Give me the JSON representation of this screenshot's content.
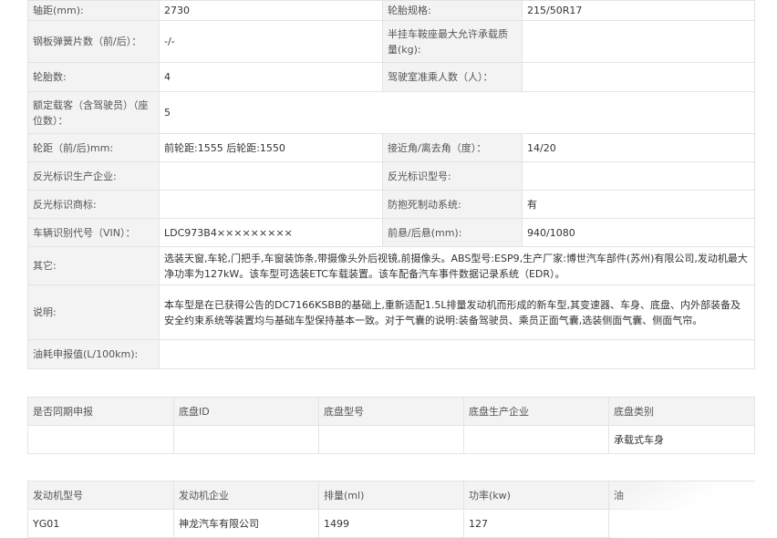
{
  "spec": {
    "wheelbase_label": "轴距(mm):",
    "wheelbase_value": "2730",
    "tire_label": "轮胎规格:",
    "tire_value": "215/50R17",
    "leaf_spring_label": "钢板弹簧片数（前/后）：",
    "leaf_spring_value": "-/-",
    "saddle_label": "半挂车鞍座最大允许承载质量(kg):",
    "saddle_value": "",
    "tire_count_label": "轮胎数:",
    "tire_count_value": "4",
    "cab_passengers_label": "驾驶室准乘人数（人）：",
    "cab_passengers_value": "",
    "rated_passengers_label": "额定载客（含驾驶员）（座位数）：",
    "rated_passengers_value": "5",
    "track_label": "轮距（前/后)mm:",
    "track_value": "前轮距:1555 后轮距:1550",
    "angle_label": "接近角/离去角（度）：",
    "angle_value": "14/20",
    "reflector_maker_label": "反光标识生产企业:",
    "reflector_maker_value": "",
    "reflector_model_label": "反光标识型号:",
    "reflector_model_value": "",
    "reflector_brand_label": "反光标识商标:",
    "reflector_brand_value": "",
    "abs_label": "防抱死制动系统:",
    "abs_value": "有",
    "vin_label": "车辆识别代号（VIN）：",
    "vin_value": "LDC973B4×××××××××",
    "overhang_label": "前悬/后悬(mm):",
    "overhang_value": "940/1080",
    "other_label": "其它:",
    "other_value": "选装天窗,车轮,门把手,车窗装饰条,带摄像头外后视镜,前摄像头。ABS型号:ESP9,生产厂家:博世汽车部件(苏州)有限公司,发动机最大净功率为127kW。该车型可选装ETC车载装置。该车配备汽车事件数据记录系统（EDR）。",
    "note_label": "说明:",
    "note_value": "本车型是在已获得公告的DC7166KSBB的基础上,重新适配1.5L排量发动机而形成的新车型,其变速器、车身、底盘、内外部装备及安全约束系统等装置均与基础车型保持基本一致。对于气囊的说明:装备驾驶员、乘员正面气囊,选装侧面气囊、侧面气帘。",
    "fuel_label": "油耗申报值(L/100km):",
    "fuel_value": ""
  },
  "chassis": {
    "headers": [
      "是否同期申报",
      "底盘ID",
      "底盘型号",
      "底盘生产企业",
      "底盘类别"
    ],
    "row": [
      "",
      "",
      "",
      "",
      "承载式车身"
    ]
  },
  "engine": {
    "headers": [
      "发动机型号",
      "发动机企业",
      "排量(ml)",
      "功率(kw)",
      "油"
    ],
    "row": [
      "YG01",
      "神龙汽车有限公司",
      "1499",
      "127",
      ""
    ]
  }
}
